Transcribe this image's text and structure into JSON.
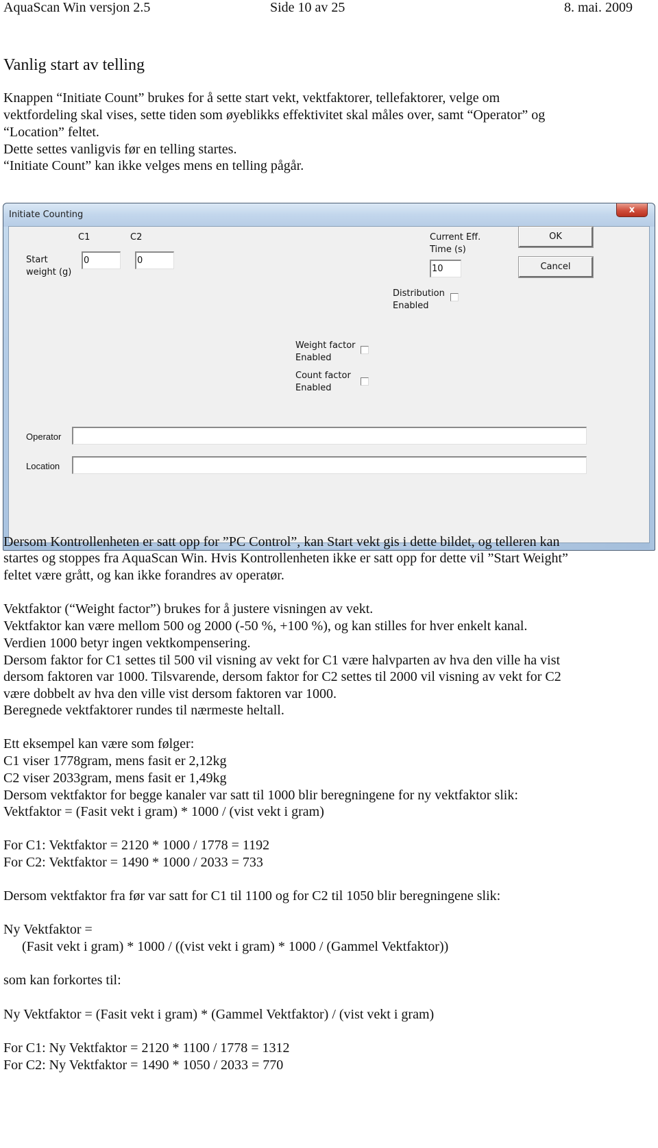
{
  "header": {
    "left": "AquaScan Win versjon 2.5",
    "center": "Side 10 av 25",
    "right": "8. mai. 2009"
  },
  "heading": "Vanlig start av telling",
  "intro": [
    "Knappen “Initiate Count” brukes for å sette start vekt, vektfaktorer, tellefaktorer, velge om",
    "vektfordeling skal vises, sette tiden som øyeblikks effektivitet skal måles over, samt “Operator” og",
    "“Location” feltet.",
    "Dette settes vanligvis før en telling startes.",
    "“Initiate Count” kan ikke velges mens en telling pågår."
  ],
  "dialog": {
    "title": "Initiate Counting",
    "close_label": "x",
    "c1_label": "C1",
    "c2_label": "C2",
    "start_weight_label_1": "Start",
    "start_weight_label_2": "weight (g)",
    "c1_value": "0",
    "c2_value": "0",
    "eff_time_label_1": "Current Eff.",
    "eff_time_label_2": "Time (s)",
    "eff_time_value": "10",
    "ok_label": "OK",
    "cancel_label": "Cancel",
    "distribution_label_1": "Distribution",
    "distribution_label_2": "Enabled",
    "distribution_checked": false,
    "weight_factor_label_1": "Weight factor",
    "weight_factor_label_2": "Enabled",
    "weight_factor_checked": false,
    "count_factor_label_1": "Count factor",
    "count_factor_label_2": "Enabled",
    "count_factor_checked": false,
    "operator_label": "Operator",
    "operator_value": "",
    "location_label": "Location",
    "location_value": ""
  },
  "body_paragraphs": [
    "Dersom Kontrollenheten er satt opp for ”PC Control”, kan Start vekt gis i dette bildet, og telleren kan",
    "startes og stoppes fra AquaScan Win. Hvis Kontrollenheten ikke er satt opp for dette vil ”Start Weight”",
    "feltet være grått, og kan ikke forandres av operatør.",
    "Vektfaktor (“Weight factor”) brukes for å justere visningen av vekt.",
    "Vektfaktor kan være mellom 500 og 2000 (-50 %, +100 %), og kan stilles for hver enkelt kanal.",
    "Verdien 1000 betyr ingen vektkompensering.",
    "Dersom faktor for C1 settes til 500 vil visning av vekt for C1 være halvparten av hva den ville ha vist",
    "dersom faktoren var 1000. Tilsvarende, dersom faktor for C2 settes til 2000 vil visning av vekt for C2",
    "være dobbelt av hva den ville vist dersom faktoren var 1000.",
    "Beregnede vektfaktorer rundes til nærmeste heltall.",
    "Ett eksempel kan være som følger:",
    "C1 viser 1778gram, mens fasit er 2,12kg",
    "C2 viser 2033gram, mens fasit er 1,49kg",
    "Dersom vektfaktor for begge kanaler var satt til 1000 blir beregningene for ny vektfaktor slik:",
    "Vektfaktor = (Fasit vekt i gram) * 1000 / (vist vekt i gram)",
    "For C1: Vektfaktor = 2120 * 1000 / 1778 = 1192",
    "For C2: Vektfaktor = 1490 * 1000 / 2033 = 733",
    "Dersom vektfaktor fra før var satt for C1 til 1100 og for C2 til 1050 blir beregningene slik:",
    "Ny Vektfaktor =",
    "(Fasit vekt i gram) * 1000 / ((vist vekt i gram) * 1000 / (Gammel Vektfaktor))",
    "som kan forkortes til:",
    "Ny Vektfaktor = (Fasit vekt i gram) * (Gammel Vektfaktor)  / (vist vekt i gram)",
    "For C1: Ny Vektfaktor = 2120 * 1100 / 1778 = 1312",
    "For C2: Ny Vektfaktor = 1490 * 1050 / 2033 = 770"
  ]
}
